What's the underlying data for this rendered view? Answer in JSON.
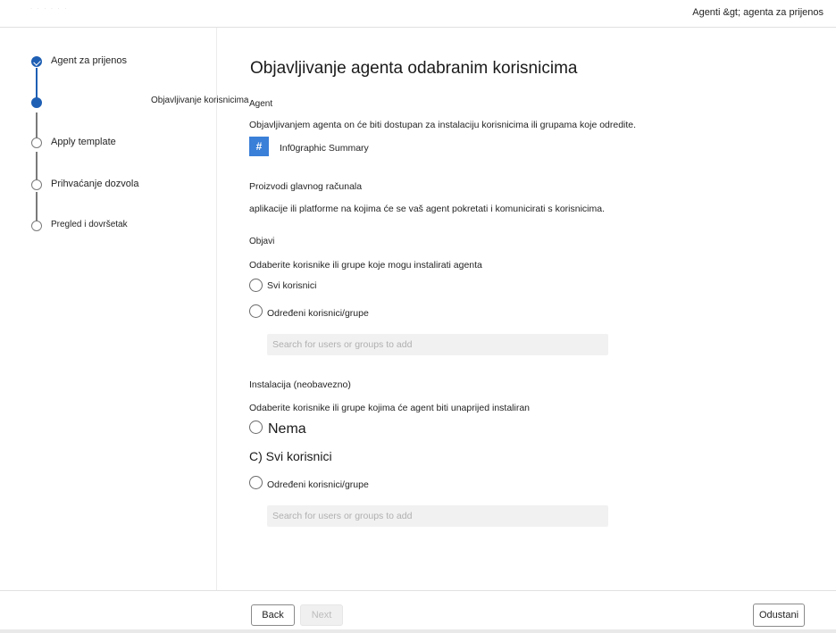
{
  "header": {
    "breadcrumb": "Agenti &gt; agenta za prijenos",
    "faint_text": "· · · · · ·"
  },
  "steps": [
    {
      "label": "Agent za prijenos",
      "state": "done"
    },
    {
      "label": "Objavljivanje korisnicima",
      "state": "current"
    },
    {
      "label": "Apply template",
      "state": "pending"
    },
    {
      "label": "Prihvaćanje dozvola",
      "state": "pending"
    },
    {
      "label": "Pregled i dovršetak",
      "state": "pending"
    }
  ],
  "main": {
    "title": "Objavljivanje agenta odabranim korisnicima",
    "agent_heading": "Agent",
    "agent_desc": "Objavljivanjem agenta on će biti dostupan za instalaciju korisnicima ili grupama koje odredite.",
    "agent_icon_glyph": "#",
    "agent_name": "Inf0graphic Summary",
    "host_heading": "Proizvodi glavnog računala",
    "host_desc": "aplikacije ili platforme na kojima će se vaš agent pokretati i komunicirati s korisnicima.",
    "publish": {
      "heading": "Objavi",
      "desc": "Odaberite korisnike ili grupe koje mogu instalirati agenta",
      "option_all": "Svi korisnici",
      "option_specific": "Određeni korisnici/grupe",
      "search_placeholder": "Search for users or groups to add"
    },
    "install": {
      "heading": "Instalacija (neobavezno)",
      "desc": "Odaberite korisnike ili grupe kojima će agent biti unaprijed instaliran",
      "option_none": "Nema",
      "option_all": "C) Svi korisnici",
      "option_specific": "Određeni korisnici/grupe",
      "search_placeholder": "Search for users or groups to add"
    }
  },
  "footer": {
    "back_label": "Back",
    "next_label": "Next",
    "cancel_label": "Odustani"
  },
  "colors": {
    "accent": "#1f5fb4",
    "agent_icon_bg": "#3a7fd8"
  }
}
